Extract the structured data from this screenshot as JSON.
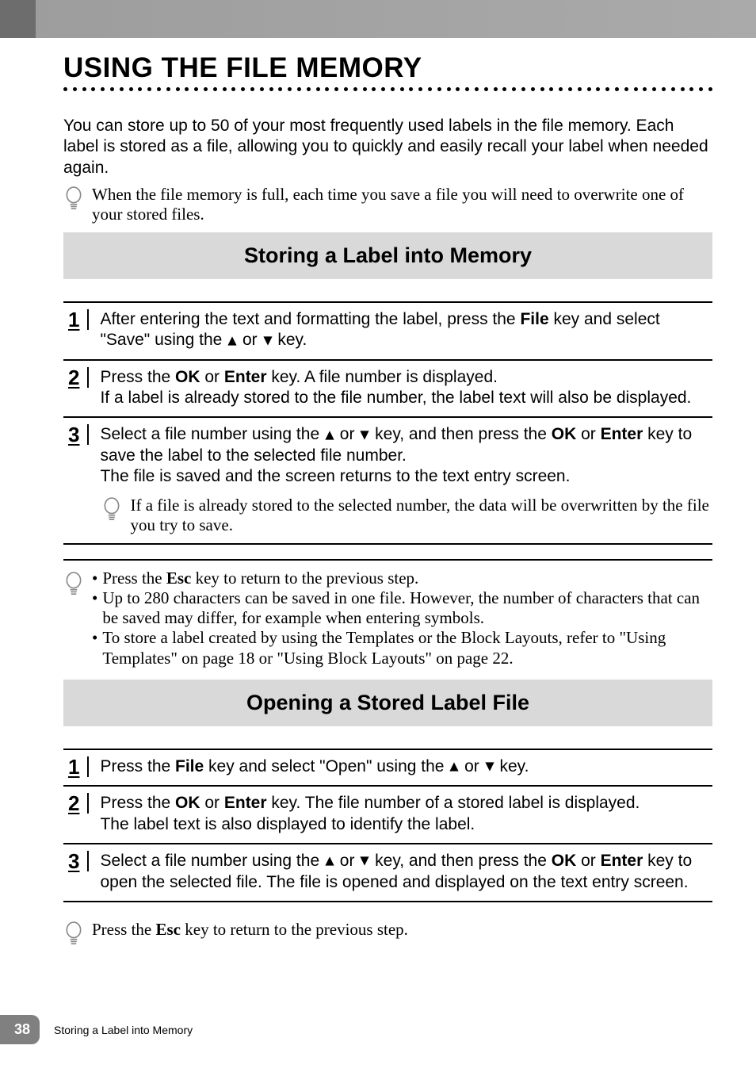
{
  "title": "USING THE FILE MEMORY",
  "intro": "You can store up to 50 of your most frequently used labels in the file memory. Each label is stored as a file, allowing you to quickly and easily recall your label when needed again.",
  "intro_note": "When the file memory is full, each time you save a file you will need to overwrite one of your stored files.",
  "section1": {
    "heading": "Storing a Label into Memory",
    "steps": [
      {
        "num": "1",
        "pre": "After entering the text and formatting the label, press the ",
        "key1": "File",
        "mid": " key and select \"Save\" using the ",
        "post": " key."
      },
      {
        "num": "2",
        "line1_pre": "Press the ",
        "k1": "OK",
        "or": " or ",
        "k2": "Enter",
        "line1_post": " key. A file number is displayed.",
        "line2": "If a label is already stored to the file number, the label text will also be displayed."
      },
      {
        "num": "3",
        "line1_pre": "Select a file number using the ",
        "line1_mid": " key, and then press the ",
        "k1": "OK",
        "or": " or ",
        "k2": "Enter",
        "line1_post": " key to save the label to the selected file number.",
        "line2": "The file is saved and the screen returns to the text entry screen.",
        "note": "If a file is already stored to the selected number, the data will be overwritten by the file you try to save."
      }
    ],
    "bullets": [
      {
        "pre": "Press the ",
        "key": "Esc",
        "post": " key to return to the previous step."
      },
      {
        "text": "Up to 280 characters can be saved in one file. However, the number of characters that can be saved may differ, for example when entering symbols."
      },
      {
        "text": "To store a label created by using the Templates or the Block Layouts, refer to \"Using Templates\" on page 18 or \"Using Block Layouts\" on page 22."
      }
    ]
  },
  "section2": {
    "heading": "Opening a Stored Label File",
    "steps": [
      {
        "num": "1",
        "pre": "Press the ",
        "key1": "File",
        "mid": " key and select \"Open\" using the ",
        "post": " key."
      },
      {
        "num": "2",
        "line1_pre": "Press the ",
        "k1": "OK",
        "or": " or ",
        "k2": "Enter",
        "line1_post": " key. The file number of a stored label is displayed.",
        "line2": "The label text is also displayed to identify the label."
      },
      {
        "num": "3",
        "line1_pre": "Select a file number using the ",
        "line1_mid": " key, and then press the ",
        "k1": "OK",
        "or": " or ",
        "k2": "Enter",
        "line1_post": " key to open the selected file. The file is opened and displayed on the text entry screen."
      }
    ],
    "foot_note_pre": "Press the ",
    "foot_note_key": "Esc",
    "foot_note_post": " key to return to the previous step."
  },
  "footer": {
    "page_num": "38",
    "caption": "Storing a Label into Memory"
  }
}
